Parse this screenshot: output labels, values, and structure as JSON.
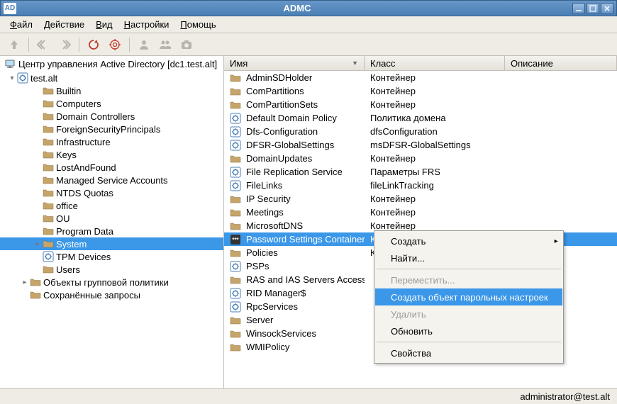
{
  "window": {
    "app_icon_text": "AD",
    "title": "ADMC"
  },
  "menu": {
    "items": [
      {
        "label": "Файл",
        "hotkey_idx": 0
      },
      {
        "label": "Действие",
        "hotkey_idx": 0
      },
      {
        "label": "Вид",
        "hotkey_idx": 0
      },
      {
        "label": "Настройки",
        "hotkey_idx": 0
      },
      {
        "label": "Помощь",
        "hotkey_idx": 0
      }
    ]
  },
  "toolbar_icons": [
    "up-icon",
    "back-icon",
    "forward-icon",
    "refresh-icon",
    "target-icon",
    "user-icon",
    "users-icon",
    "camera-icon"
  ],
  "tree": {
    "root_label": "Центр управления Active Directory [dc1.test.alt]",
    "domain": "test.alt",
    "items": [
      {
        "label": "Builtin",
        "icon": "folder",
        "indent": 2
      },
      {
        "label": "Computers",
        "icon": "folder",
        "indent": 2
      },
      {
        "label": "Domain Controllers",
        "icon": "folder",
        "indent": 2
      },
      {
        "label": "ForeignSecurityPrincipals",
        "icon": "folder",
        "indent": 2
      },
      {
        "label": "Infrastructure",
        "icon": "folder",
        "indent": 2
      },
      {
        "label": "Keys",
        "icon": "folder",
        "indent": 2
      },
      {
        "label": "LostAndFound",
        "icon": "folder",
        "indent": 2
      },
      {
        "label": "Managed Service Accounts",
        "icon": "folder",
        "indent": 2
      },
      {
        "label": "NTDS Quotas",
        "icon": "folder",
        "indent": 2
      },
      {
        "label": "office",
        "icon": "folder",
        "indent": 2
      },
      {
        "label": "OU",
        "icon": "folder",
        "indent": 2
      },
      {
        "label": "Program Data",
        "icon": "folder",
        "indent": 2
      },
      {
        "label": "System",
        "icon": "folder",
        "indent": 2,
        "selected": true,
        "expandable": true
      },
      {
        "label": "TPM Devices",
        "icon": "gear",
        "indent": 2
      },
      {
        "label": "Users",
        "icon": "folder",
        "indent": 2
      }
    ],
    "bottom_items": [
      {
        "label": "Объекты групповой политики",
        "icon": "folder",
        "indent": 1,
        "expandable": true
      },
      {
        "label": "Сохранённые запросы",
        "icon": "folder",
        "indent": 1
      }
    ]
  },
  "list": {
    "columns": {
      "name": "Имя",
      "class": "Класс",
      "desc": "Описание"
    },
    "sort_indicator": "▼",
    "rows": [
      {
        "name": "AdminSDHolder",
        "class": "Контейнер",
        "icon": "folder"
      },
      {
        "name": "ComPartitions",
        "class": "Контейнер",
        "icon": "folder"
      },
      {
        "name": "ComPartitionSets",
        "class": "Контейнер",
        "icon": "folder"
      },
      {
        "name": "Default Domain Policy",
        "class": "Политика домена",
        "icon": "gear"
      },
      {
        "name": "Dfs-Configuration",
        "class": "dfsConfiguration",
        "icon": "gear"
      },
      {
        "name": "DFSR-GlobalSettings",
        "class": "msDFSR-GlobalSettings",
        "icon": "gear"
      },
      {
        "name": "DomainUpdates",
        "class": "Контейнер",
        "icon": "folder"
      },
      {
        "name": "File Replication Service",
        "class": "Параметры FRS",
        "icon": "gear"
      },
      {
        "name": "FileLinks",
        "class": "fileLinkTracking",
        "icon": "gear"
      },
      {
        "name": "IP Security",
        "class": "Контейнер",
        "icon": "folder"
      },
      {
        "name": "Meetings",
        "class": "Контейнер",
        "icon": "folder"
      },
      {
        "name": "MicrosoftDNS",
        "class": "Контейнер",
        "icon": "folder"
      },
      {
        "name": "Password Settings Container",
        "class": "Контейнер",
        "icon": "pwd",
        "selected": true
      },
      {
        "name": "Policies",
        "class": "Контейнер",
        "icon": "folder"
      },
      {
        "name": "PSPs",
        "class": "",
        "icon": "gear"
      },
      {
        "name": "RAS and IAS Servers Access ...",
        "class": "",
        "icon": "folder"
      },
      {
        "name": "RID Manager$",
        "class": "",
        "icon": "gear"
      },
      {
        "name": "RpcServices",
        "class": "",
        "icon": "gear"
      },
      {
        "name": "Server",
        "class": "",
        "icon": "folder"
      },
      {
        "name": "WinsockServices",
        "class": "",
        "icon": "folder"
      },
      {
        "name": "WMIPolicy",
        "class": "",
        "icon": "folder"
      }
    ]
  },
  "context_menu": {
    "items": [
      {
        "label": "Создать",
        "submenu": true
      },
      {
        "label": "Найти..."
      },
      {
        "sep": true
      },
      {
        "label": "Переместить...",
        "disabled": true
      },
      {
        "label": "Создать объект парольных настроек",
        "highlighted": true
      },
      {
        "label": "Удалить",
        "disabled": true
      },
      {
        "label": "Обновить"
      },
      {
        "sep": true
      },
      {
        "label": "Свойства"
      }
    ]
  },
  "status": {
    "user": "administrator@test.alt"
  }
}
